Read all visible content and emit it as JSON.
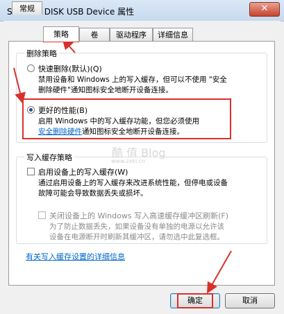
{
  "window": {
    "title": "SMI USB DISK USB Device 属性",
    "close_label": "✕"
  },
  "tabs": [
    {
      "label": "常规"
    },
    {
      "label": "策略"
    },
    {
      "label": "卷"
    },
    {
      "label": "驱动程序"
    },
    {
      "label": "详细信息"
    }
  ],
  "removal_policy": {
    "group_label": "删除策略",
    "quick": {
      "label": "快速删除(默认)(Q)",
      "desc_line1": "禁用设备和 Windows 上的写入缓存，但可以不使用 \"安全",
      "desc_line2": "删除硬件\"通知图标安全地断开设备连接。"
    },
    "performance": {
      "label": "更好的性能(B)",
      "desc_line1": "启用 Windows 中的写入缓存功能，但您必须使用",
      "link": "安全删除硬件",
      "desc_line2_rest": "通知图标安全地断开设备连接。"
    }
  },
  "write_cache_policy": {
    "group_label": "写入缓存策略",
    "enable": {
      "label": "启用设备上的写入缓存(W)",
      "desc_line1": "通过启用设备上的写入缓存来改进系统性能，但停电或设备",
      "desc_line2": "故障可能会导致数据丢失或损坏。"
    },
    "flush": {
      "label": "关闭设备上的 Windows 写入高速缓存缓冲区刷新(F)",
      "desc_line1": "为了防止数据丢失，如果设备没有单独的电源以允许该",
      "desc_line2": "设备在电源断开时刷新其缓冲区，请勿选中此复选框。"
    }
  },
  "details_link": "有关写入缓存设置的详细信息",
  "buttons": {
    "ok": "确定",
    "cancel": "取消"
  },
  "watermark": {
    "line1": "酷 值 Blog",
    "line2": "www.zxki.cn"
  },
  "colors": {
    "annotation_red": "#d9302a",
    "link_blue": "#0066cc",
    "selected_radio": "#1e4f8e"
  }
}
